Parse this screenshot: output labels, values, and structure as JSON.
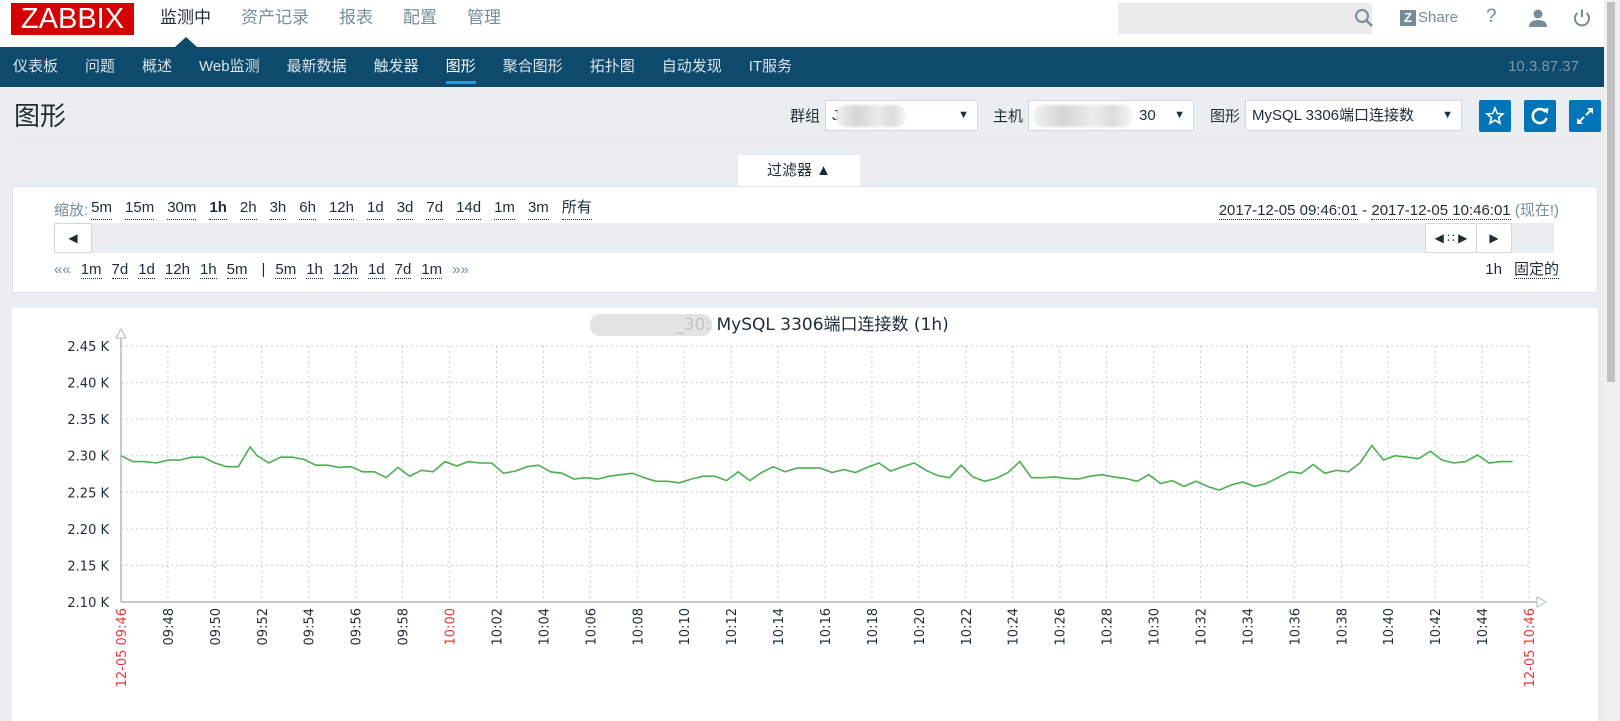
{
  "header": {
    "logo": "ZABBIX",
    "top_menu": [
      {
        "label": "监测中",
        "active": true
      },
      {
        "label": "资产记录",
        "active": false
      },
      {
        "label": "报表",
        "active": false
      },
      {
        "label": "配置",
        "active": false
      },
      {
        "label": "管理",
        "active": false
      }
    ],
    "search_placeholder": "",
    "share_label": "Share",
    "share_logo": "Z",
    "help_label": "?",
    "icons": [
      "search-icon",
      "share-icon",
      "help-icon",
      "user-icon",
      "power-icon"
    ]
  },
  "subnav": {
    "items": [
      {
        "label": "仪表板",
        "active": false
      },
      {
        "label": "问题",
        "active": false
      },
      {
        "label": "概述",
        "active": false
      },
      {
        "label": "Web监测",
        "active": false
      },
      {
        "label": "最新数据",
        "active": false
      },
      {
        "label": "触发器",
        "active": false
      },
      {
        "label": "图形",
        "active": true
      },
      {
        "label": "聚合图形",
        "active": false
      },
      {
        "label": "拓扑图",
        "active": false
      },
      {
        "label": "自动发现",
        "active": false
      },
      {
        "label": "IT服务",
        "active": false
      }
    ],
    "server_ip": "10.3.87.37"
  },
  "page": {
    "title": "图形",
    "filters": {
      "group_label": "群组",
      "group_value": "J",
      "host_label": "主机",
      "host_value_suffix": "30",
      "graph_label": "图形",
      "graph_value": "MySQL 3306端口连接数"
    },
    "buttons": {
      "favorite": "star-icon",
      "refresh": "refresh-icon",
      "fullscreen": "fullscreen-icon"
    }
  },
  "filter": {
    "tab_label": "过滤器 ▲",
    "zoom_label": "缩放:",
    "zoom_options": [
      "5m",
      "15m",
      "30m",
      "1h",
      "2h",
      "3h",
      "6h",
      "12h",
      "1d",
      "3d",
      "7d",
      "14d",
      "1m",
      "3m",
      "所有"
    ],
    "zoom_selected": "1h",
    "period_from": "2017-12-05 09:46:01",
    "period_sep": " - ",
    "period_to": "2017-12-05 10:46:01",
    "period_now": "(现在!)",
    "back_arrows": "««",
    "back_options": [
      "1m",
      "7d",
      "1d",
      "12h",
      "1h",
      "5m"
    ],
    "separator": "|",
    "fwd_options": [
      "5m",
      "1h",
      "12h",
      "1d",
      "7d",
      "1m"
    ],
    "fwd_arrows": "»»",
    "period_length": "1h",
    "fixed_label": "固定的",
    "slider_left": "◀",
    "slider_handle": "◀ ∷ ▶",
    "slider_right": "▶"
  },
  "chart_data": {
    "type": "line",
    "title": "_30: MySQL 3306端口连接数 (1h)",
    "title_prefix_blurred": true,
    "xlabel": "",
    "ylabel": "",
    "ylim": [
      2100,
      2450
    ],
    "yticks": [
      "2.10 K",
      "2.15 K",
      "2.20 K",
      "2.25 K",
      "2.30 K",
      "2.35 K",
      "2.40 K",
      "2.45 K"
    ],
    "ytick_values": [
      2100,
      2150,
      2200,
      2250,
      2300,
      2350,
      2400,
      2450
    ],
    "xlim_minutes": [
      0,
      60
    ],
    "xticks": [
      {
        "label": "12-05 09:46",
        "minute": 0,
        "highlight": true
      },
      {
        "label": "09:48",
        "minute": 2
      },
      {
        "label": "09:50",
        "minute": 4
      },
      {
        "label": "09:52",
        "minute": 6
      },
      {
        "label": "09:54",
        "minute": 8
      },
      {
        "label": "09:56",
        "minute": 10
      },
      {
        "label": "09:58",
        "minute": 12
      },
      {
        "label": "10:00",
        "minute": 14,
        "highlight": true
      },
      {
        "label": "10:02",
        "minute": 16
      },
      {
        "label": "10:04",
        "minute": 18
      },
      {
        "label": "10:06",
        "minute": 20
      },
      {
        "label": "10:08",
        "minute": 22
      },
      {
        "label": "10:10",
        "minute": 24
      },
      {
        "label": "10:12",
        "minute": 26
      },
      {
        "label": "10:14",
        "minute": 28
      },
      {
        "label": "10:16",
        "minute": 30
      },
      {
        "label": "10:18",
        "minute": 32
      },
      {
        "label": "10:20",
        "minute": 34
      },
      {
        "label": "10:22",
        "minute": 36
      },
      {
        "label": "10:24",
        "minute": 38
      },
      {
        "label": "10:26",
        "minute": 40
      },
      {
        "label": "10:28",
        "minute": 42
      },
      {
        "label": "10:30",
        "minute": 44
      },
      {
        "label": "10:32",
        "minute": 46
      },
      {
        "label": "10:34",
        "minute": 48
      },
      {
        "label": "10:36",
        "minute": 50
      },
      {
        "label": "10:38",
        "minute": 52
      },
      {
        "label": "10:40",
        "minute": 54
      },
      {
        "label": "10:42",
        "minute": 56
      },
      {
        "label": "10:44",
        "minute": 58
      },
      {
        "label": "12-05 10:46",
        "minute": 60,
        "highlight": true
      }
    ],
    "grid": true,
    "series": [
      {
        "name": "MySQL 3306端口连接数",
        "color": "#4caf50",
        "x_minutes": [
          0,
          0.5,
          1,
          1.5,
          2,
          2.5,
          3,
          3.5,
          4,
          4.5,
          5,
          5.5,
          5.8,
          6.3,
          6.8,
          7.3,
          7.8,
          8.3,
          8.8,
          9.3,
          9.8,
          10.3,
          10.8,
          11.3,
          11.8,
          12.3,
          12.8,
          13.3,
          13.8,
          14.3,
          14.8,
          15.3,
          15.8,
          16.3,
          16.8,
          17.3,
          17.8,
          18.3,
          18.8,
          19.3,
          19.8,
          20.3,
          20.8,
          21.3,
          21.8,
          22.3,
          22.8,
          23.3,
          23.8,
          24.3,
          24.8,
          25.3,
          25.8,
          26.3,
          26.8,
          27.3,
          27.8,
          28.3,
          28.8,
          29.3,
          29.8,
          30.3,
          30.8,
          31.3,
          31.8,
          32.3,
          32.8,
          33.3,
          33.8,
          34.3,
          34.8,
          35.3,
          35.8,
          36.3,
          36.8,
          37.3,
          37.8,
          38.3,
          38.8,
          39.3,
          39.8,
          40.3,
          40.8,
          41.3,
          41.8,
          42.3,
          42.8,
          43.3,
          43.8,
          44.3,
          44.8,
          45.3,
          45.8,
          46.3,
          46.8,
          47.3,
          47.8,
          48.3,
          48.8,
          49.3,
          49.8,
          50.3,
          50.8,
          51.3,
          51.8,
          52.3,
          52.8,
          53.3,
          53.8,
          54.3,
          54.8,
          55.3,
          55.8,
          56.3,
          56.8,
          57.3,
          57.8,
          58.3,
          58.8,
          59.3,
          60
        ],
        "values": [
          2300,
          2292,
          2292,
          2290,
          2294,
          2294,
          2298,
          2298,
          2290,
          2285,
          2285,
          2312,
          2300,
          2290,
          2298,
          2298,
          2295,
          2287,
          2287,
          2284,
          2285,
          2278,
          2278,
          2270,
          2284,
          2272,
          2280,
          2278,
          2292,
          2286,
          2292,
          2290,
          2290,
          2276,
          2279,
          2285,
          2287,
          2278,
          2276,
          2268,
          2270,
          2268,
          2272,
          2274,
          2276,
          2270,
          2265,
          2265,
          2263,
          2268,
          2272,
          2272,
          2266,
          2278,
          2266,
          2277,
          2285,
          2278,
          2283,
          2283,
          2283,
          2277,
          2281,
          2277,
          2284,
          2290,
          2279,
          2285,
          2290,
          2280,
          2273,
          2270,
          2287,
          2271,
          2265,
          2269,
          2277,
          2292,
          2270,
          2270,
          2271,
          2269,
          2268,
          2272,
          2274,
          2271,
          2269,
          2265,
          2274,
          2262,
          2266,
          2258,
          2265,
          2258,
          2253,
          2260,
          2264,
          2258,
          2262,
          2270,
          2278,
          2276,
          2288,
          2276,
          2280,
          2278,
          2290,
          2314,
          2294,
          2300,
          2298,
          2296,
          2306,
          2294,
          2290,
          2292,
          2301,
          2290,
          2292,
          2292
        ]
      }
    ]
  }
}
